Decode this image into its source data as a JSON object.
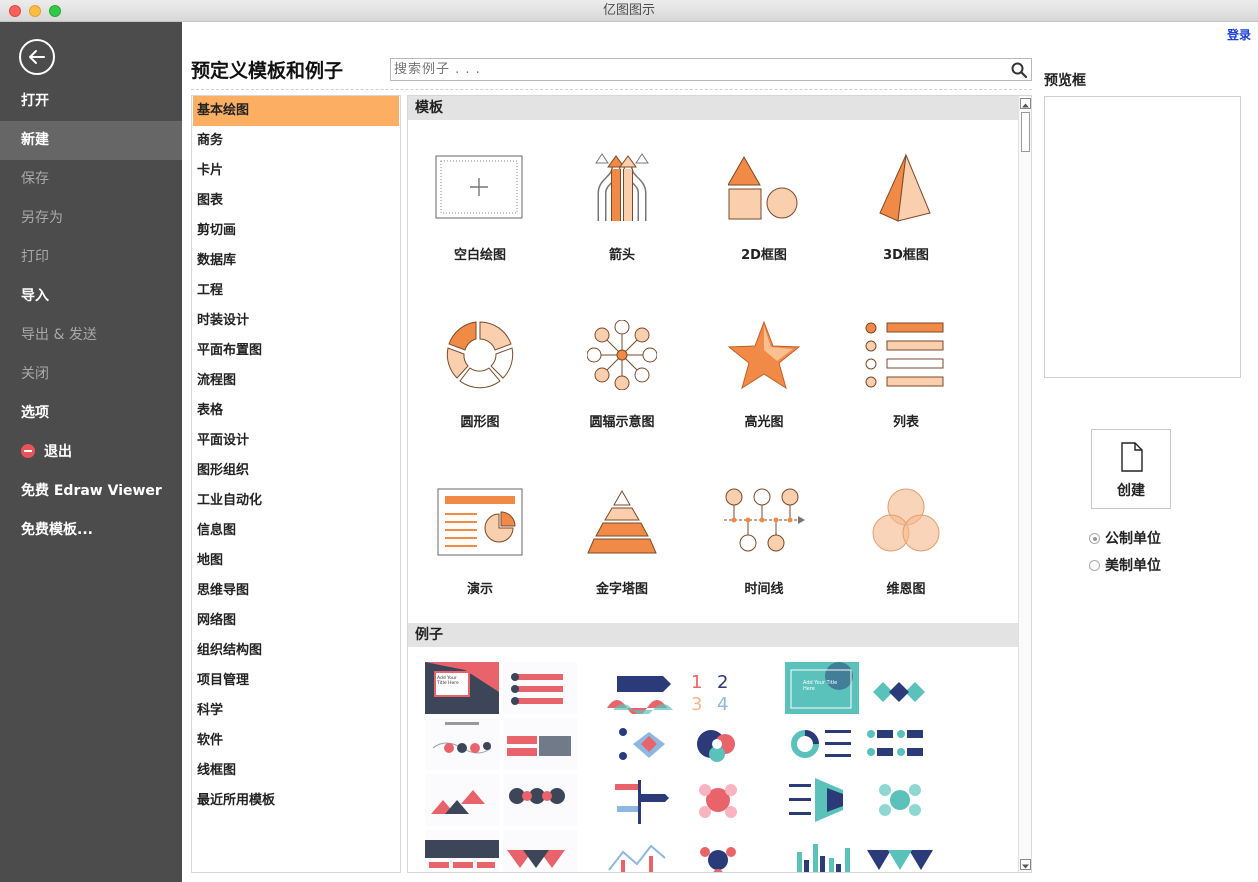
{
  "window": {
    "title": "亿图图示"
  },
  "sidebar": {
    "items": [
      {
        "label": "打开",
        "state": "normal"
      },
      {
        "label": "新建",
        "state": "active"
      },
      {
        "label": "保存",
        "state": "dim"
      },
      {
        "label": "另存为",
        "state": "dim"
      },
      {
        "label": "打印",
        "state": "dim"
      },
      {
        "label": "导入",
        "state": "normal"
      },
      {
        "label": "导出 & 发送",
        "state": "dim"
      },
      {
        "label": "关闭",
        "state": "dim"
      },
      {
        "label": "选项",
        "state": "normal"
      },
      {
        "label": "退出",
        "state": "normal"
      },
      {
        "label": "免费 Edraw Viewer",
        "state": "normal"
      },
      {
        "label": "免费模板...",
        "state": "normal"
      }
    ]
  },
  "header": {
    "login": "登录",
    "title": "预定义模板和例子"
  },
  "search": {
    "placeholder": "搜索例子 . . ."
  },
  "categories": [
    "基本绘图",
    "商务",
    "卡片",
    "图表",
    "剪切画",
    "数据库",
    "工程",
    "时装设计",
    "平面布置图",
    "流程图",
    "表格",
    "平面设计",
    "图形组织",
    "工业自动化",
    "信息图",
    "地图",
    "思维导图",
    "网络图",
    "组织结构图",
    "项目管理",
    "科学",
    "软件",
    "线框图",
    "最近所用模板"
  ],
  "selected_category": "基本绘图",
  "templates": {
    "header": "模板",
    "items": [
      {
        "label": "空白绘图",
        "icon": "blank-drawing-icon"
      },
      {
        "label": "箭头",
        "icon": "arrows-icon"
      },
      {
        "label": "2D框图",
        "icon": "2d-block-icon"
      },
      {
        "label": "3D框图",
        "icon": "3d-block-icon"
      },
      {
        "label": "圆形图",
        "icon": "circular-diagram-icon"
      },
      {
        "label": "圆辐示意图",
        "icon": "spoke-diagram-icon"
      },
      {
        "label": "高光图",
        "icon": "highlight-star-icon"
      },
      {
        "label": "列表",
        "icon": "list-icon"
      },
      {
        "label": "演示",
        "icon": "presentation-icon"
      },
      {
        "label": "金字塔图",
        "icon": "pyramid-icon"
      },
      {
        "label": "时间线",
        "icon": "timeline-icon"
      },
      {
        "label": "维恩图",
        "icon": "venn-icon"
      }
    ]
  },
  "examples": {
    "header": "例子",
    "thumb_text": "Add Your Title Here"
  },
  "right_panel": {
    "preview_title": "预览框",
    "create_label": "创建",
    "units": [
      {
        "label": "公制单位",
        "checked": true
      },
      {
        "label": "美制单位",
        "checked": false
      }
    ]
  },
  "colors": {
    "accent": "#fcaf62",
    "orange": "#f08a46",
    "peach": "#f9cfae",
    "sidebar": "#4c4c4c",
    "coral": "#e9646a",
    "navy": "#2b3a78",
    "teal": "#5bc2bb"
  }
}
